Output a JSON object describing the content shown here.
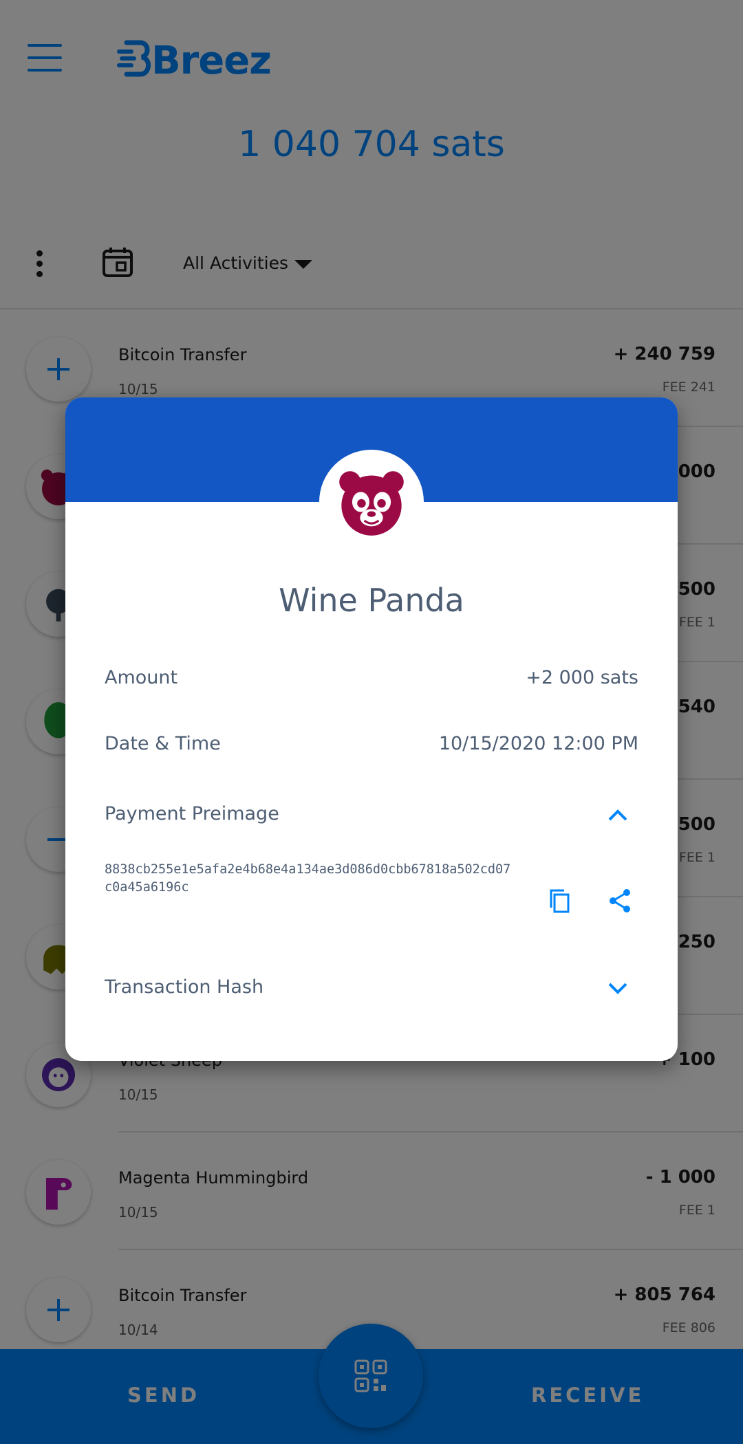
{
  "header": {
    "logo_text": "Breez",
    "balance": "1 040 704  sats"
  },
  "filter": {
    "label": "All Activities"
  },
  "transactions": [
    {
      "title": "Bitcoin Transfer",
      "date": "10/15",
      "amount": "+ 240 759",
      "fee": "FEE 241",
      "icon": "plus-icon"
    },
    {
      "title": "",
      "date": "",
      "amount": "000",
      "fee": "",
      "icon": "panda-avatar"
    },
    {
      "title": "",
      "date": "",
      "amount": "500",
      "fee": "FEE 1",
      "icon": "tree-avatar"
    },
    {
      "title": "",
      "date": "",
      "amount": "540",
      "fee": "",
      "icon": "alien-avatar"
    },
    {
      "title": "",
      "date": "",
      "amount": "500",
      "fee": "FEE 1",
      "icon": "minus-icon"
    },
    {
      "title": "",
      "date": "",
      "amount": "250",
      "fee": "",
      "icon": "octopus-avatar"
    },
    {
      "title": "Violet Sheep",
      "date": "10/15",
      "amount": "+ 100",
      "fee": "",
      "icon": "sheep-avatar"
    },
    {
      "title": "Magenta Hummingbird",
      "date": "10/15",
      "amount": "- 1 000",
      "fee": "FEE 1",
      "icon": "hummingbird-avatar"
    },
    {
      "title": "Bitcoin Transfer",
      "date": "10/14",
      "amount": "+ 805 764",
      "fee": "FEE 806",
      "icon": "plus-icon"
    }
  ],
  "bottom_bar": {
    "send_label": "SEND",
    "receive_label": "RECEIVE"
  },
  "dialog": {
    "name": "Wine Panda",
    "amount_label": "Amount",
    "amount_value": "+2 000 sats",
    "datetime_label": "Date & Time",
    "datetime_value": "10/15/2020 12:00 PM",
    "preimage_label": "Payment Preimage",
    "preimage_value": "8838cb255e1e5afa2e4b68e4a134ae3d086d0cbb67818a502cd07c0a45a6196c",
    "tx_hash_label": "Transaction Hash"
  },
  "colors": {
    "brand_blue": "#0085fb",
    "dialog_header": "#1357c4",
    "panda": "#9c0a45",
    "text_muted": "#4d5d73"
  }
}
